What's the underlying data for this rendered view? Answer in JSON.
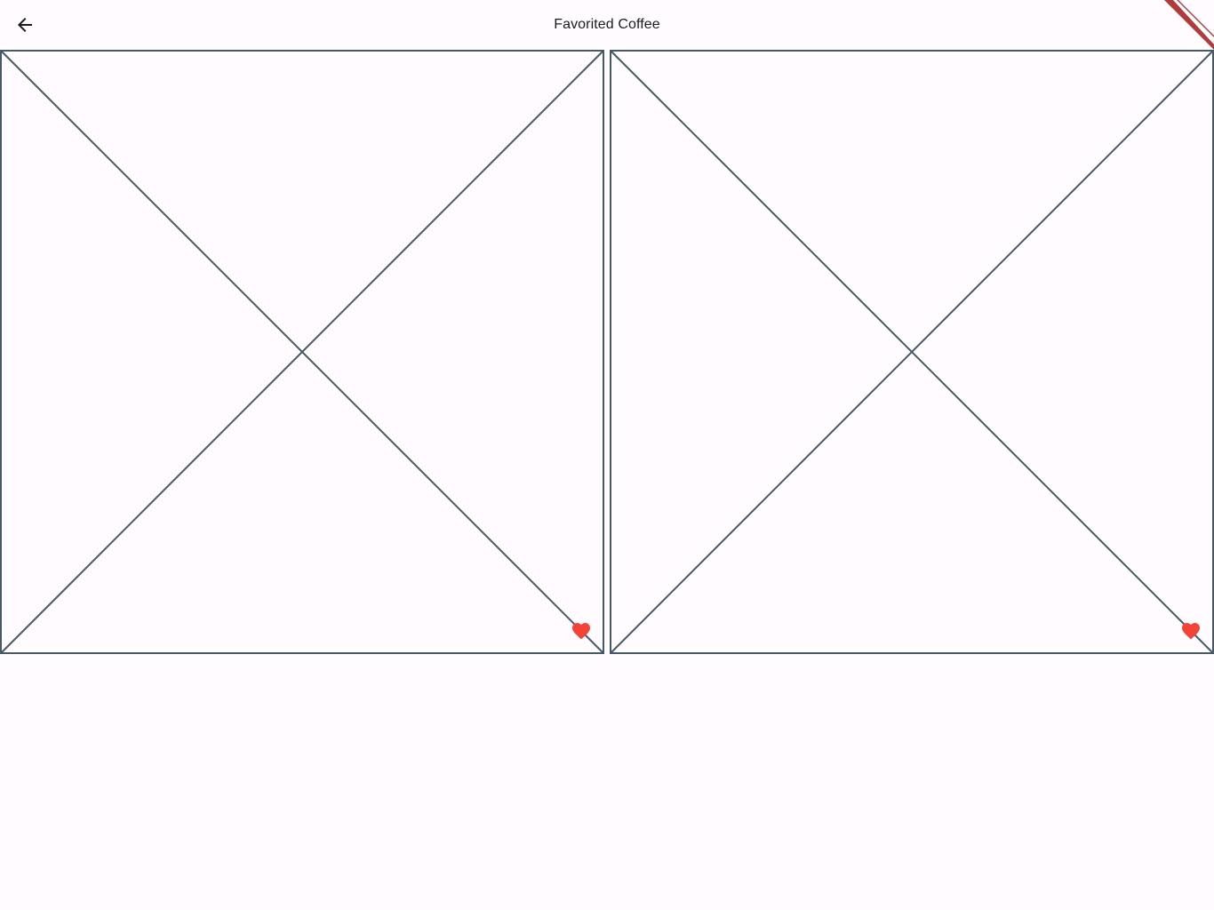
{
  "app_bar": {
    "title": "Favorited Coffee",
    "back_icon": "arrow-back-icon"
  },
  "colors": {
    "background": "#fffbfe",
    "placeholder_stroke": "#455a64",
    "favorite": "#f44336",
    "banner": "#b13b3b"
  },
  "favorites": [
    {
      "image": "placeholder",
      "icon": "heart-icon",
      "favorited": true
    },
    {
      "image": "placeholder",
      "icon": "heart-icon",
      "favorited": true
    }
  ]
}
